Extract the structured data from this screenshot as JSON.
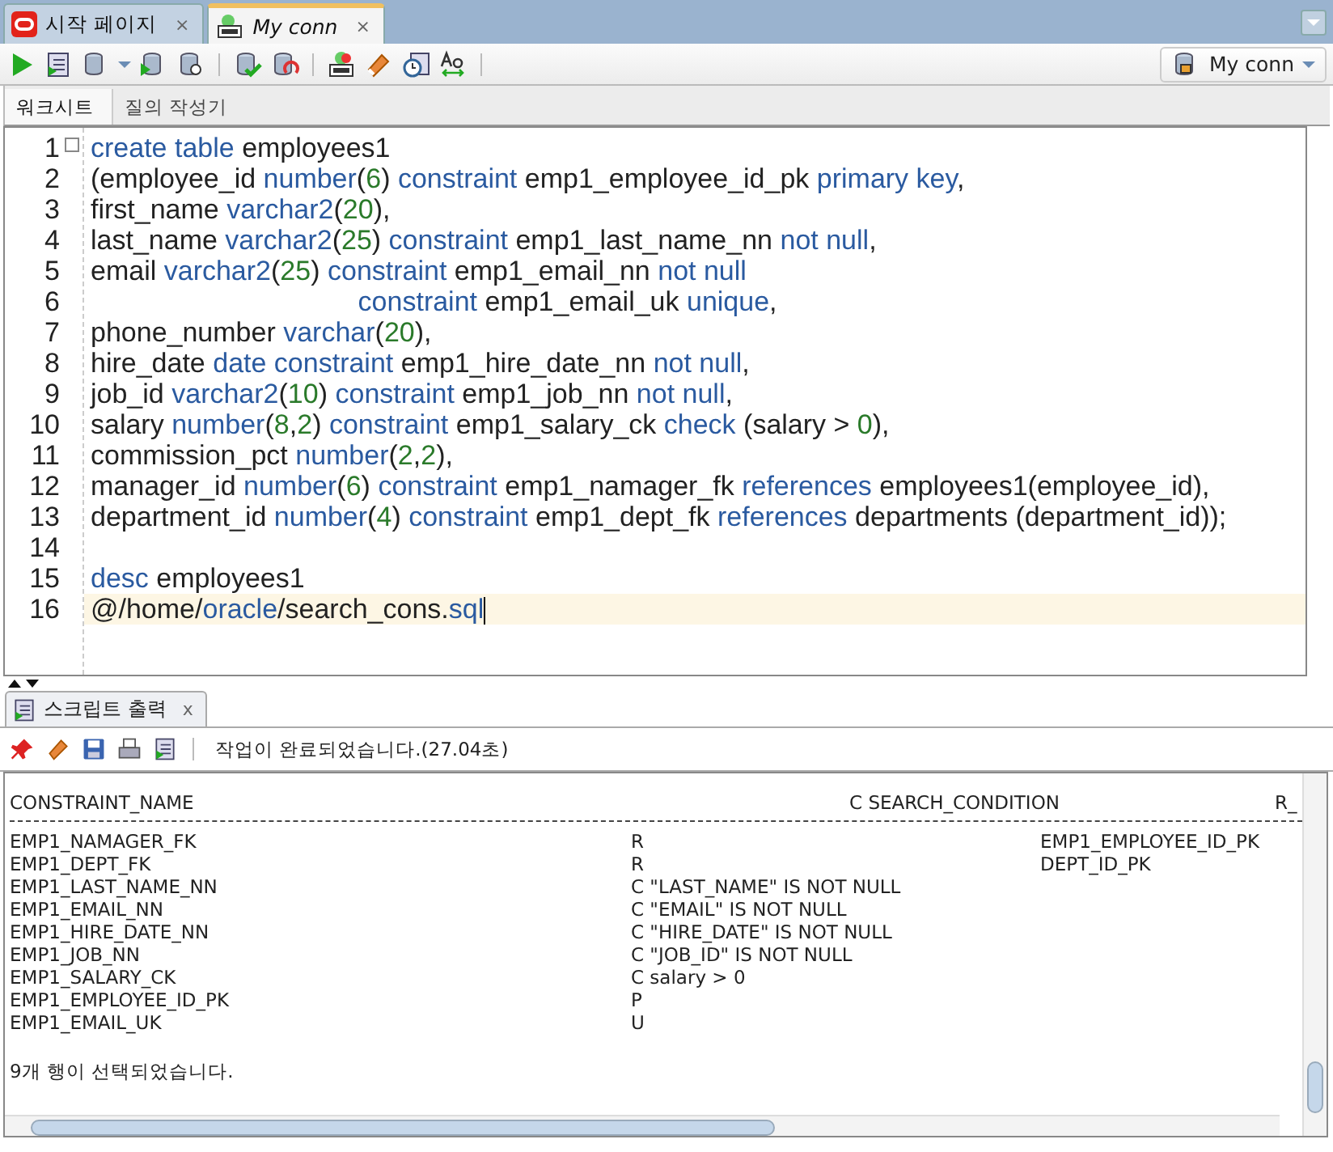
{
  "doc_tabs": [
    {
      "label": "시작 페이지",
      "kind": "start",
      "close": "×",
      "selected": false
    },
    {
      "label": "My conn",
      "kind": "sql",
      "close": "×",
      "selected": true
    }
  ],
  "connection": {
    "label": "My conn"
  },
  "sub_tabs": [
    {
      "label": "워크시트",
      "selected": true
    },
    {
      "label": "질의 작성기",
      "selected": false
    }
  ],
  "editor": {
    "lines": [
      {
        "number": "1",
        "current": false,
        "tokens": [
          {
            "text": "create table",
            "kind": "kw"
          },
          {
            "text": " employees1",
            "kind": "id"
          }
        ]
      },
      {
        "number": "2",
        "current": false,
        "tokens": [
          {
            "text": "(employee_id ",
            "kind": "id"
          },
          {
            "text": "number",
            "kind": "kw"
          },
          {
            "text": "(",
            "kind": "id"
          },
          {
            "text": "6",
            "kind": "num"
          },
          {
            "text": ") ",
            "kind": "id"
          },
          {
            "text": "constraint",
            "kind": "kw"
          },
          {
            "text": " emp1_employee_id_pk ",
            "kind": "id"
          },
          {
            "text": "primary key",
            "kind": "kw"
          },
          {
            "text": ",",
            "kind": "id"
          }
        ]
      },
      {
        "number": "3",
        "current": false,
        "tokens": [
          {
            "text": "first_name ",
            "kind": "id"
          },
          {
            "text": "varchar2",
            "kind": "kw"
          },
          {
            "text": "(",
            "kind": "id"
          },
          {
            "text": "20",
            "kind": "num"
          },
          {
            "text": "),",
            "kind": "id"
          }
        ]
      },
      {
        "number": "4",
        "current": false,
        "tokens": [
          {
            "text": "last_name ",
            "kind": "id"
          },
          {
            "text": "varchar2",
            "kind": "kw"
          },
          {
            "text": "(",
            "kind": "id"
          },
          {
            "text": "25",
            "kind": "num"
          },
          {
            "text": ") ",
            "kind": "id"
          },
          {
            "text": "constraint",
            "kind": "kw"
          },
          {
            "text": " emp1_last_name_nn ",
            "kind": "id"
          },
          {
            "text": "not null",
            "kind": "kw"
          },
          {
            "text": ",",
            "kind": "id"
          }
        ]
      },
      {
        "number": "5",
        "current": false,
        "tokens": [
          {
            "text": "email ",
            "kind": "id"
          },
          {
            "text": "varchar2",
            "kind": "kw"
          },
          {
            "text": "(",
            "kind": "id"
          },
          {
            "text": "25",
            "kind": "num"
          },
          {
            "text": ") ",
            "kind": "id"
          },
          {
            "text": "constraint",
            "kind": "kw"
          },
          {
            "text": " emp1_email_nn ",
            "kind": "id"
          },
          {
            "text": "not null",
            "kind": "kw"
          }
        ]
      },
      {
        "number": "6",
        "current": false,
        "tokens": [
          {
            "text": "                                   constraint",
            "kind": "kw"
          },
          {
            "text": " emp1_email_uk ",
            "kind": "id"
          },
          {
            "text": "unique",
            "kind": "kw"
          },
          {
            "text": ",",
            "kind": "id"
          }
        ]
      },
      {
        "number": "7",
        "current": false,
        "tokens": [
          {
            "text": "phone_number ",
            "kind": "id"
          },
          {
            "text": "varchar",
            "kind": "kw"
          },
          {
            "text": "(",
            "kind": "id"
          },
          {
            "text": "20",
            "kind": "num"
          },
          {
            "text": "),",
            "kind": "id"
          }
        ]
      },
      {
        "number": "8",
        "current": false,
        "tokens": [
          {
            "text": "hire_date ",
            "kind": "id"
          },
          {
            "text": "date constraint",
            "kind": "kw"
          },
          {
            "text": " emp1_hire_date_nn ",
            "kind": "id"
          },
          {
            "text": "not null",
            "kind": "kw"
          },
          {
            "text": ",",
            "kind": "id"
          }
        ]
      },
      {
        "number": "9",
        "current": false,
        "tokens": [
          {
            "text": "job_id ",
            "kind": "id"
          },
          {
            "text": "varchar2",
            "kind": "kw"
          },
          {
            "text": "(",
            "kind": "id"
          },
          {
            "text": "10",
            "kind": "num"
          },
          {
            "text": ") ",
            "kind": "id"
          },
          {
            "text": "constraint",
            "kind": "kw"
          },
          {
            "text": " emp1_job_nn ",
            "kind": "id"
          },
          {
            "text": "not null",
            "kind": "kw"
          },
          {
            "text": ",",
            "kind": "id"
          }
        ]
      },
      {
        "number": "10",
        "current": false,
        "tokens": [
          {
            "text": "salary ",
            "kind": "id"
          },
          {
            "text": "number",
            "kind": "kw"
          },
          {
            "text": "(",
            "kind": "id"
          },
          {
            "text": "8",
            "kind": "num"
          },
          {
            "text": ",",
            "kind": "id"
          },
          {
            "text": "2",
            "kind": "num"
          },
          {
            "text": ") ",
            "kind": "id"
          },
          {
            "text": "constraint",
            "kind": "kw"
          },
          {
            "text": " emp1_salary_ck ",
            "kind": "id"
          },
          {
            "text": "check",
            "kind": "kw"
          },
          {
            "text": " (salary > ",
            "kind": "id"
          },
          {
            "text": "0",
            "kind": "num"
          },
          {
            "text": "),",
            "kind": "id"
          }
        ]
      },
      {
        "number": "11",
        "current": false,
        "tokens": [
          {
            "text": "commission_pct ",
            "kind": "id"
          },
          {
            "text": "number",
            "kind": "kw"
          },
          {
            "text": "(",
            "kind": "id"
          },
          {
            "text": "2",
            "kind": "num"
          },
          {
            "text": ",",
            "kind": "id"
          },
          {
            "text": "2",
            "kind": "num"
          },
          {
            "text": "),",
            "kind": "id"
          }
        ]
      },
      {
        "number": "12",
        "current": false,
        "tokens": [
          {
            "text": "manager_id ",
            "kind": "id"
          },
          {
            "text": "number",
            "kind": "kw"
          },
          {
            "text": "(",
            "kind": "id"
          },
          {
            "text": "6",
            "kind": "num"
          },
          {
            "text": ") ",
            "kind": "id"
          },
          {
            "text": "constraint",
            "kind": "kw"
          },
          {
            "text": " emp1_namager_fk ",
            "kind": "id"
          },
          {
            "text": "references",
            "kind": "kw"
          },
          {
            "text": " employees1(employee_id),",
            "kind": "id"
          }
        ]
      },
      {
        "number": "13",
        "current": false,
        "tokens": [
          {
            "text": "department_id ",
            "kind": "id"
          },
          {
            "text": "number",
            "kind": "kw"
          },
          {
            "text": "(",
            "kind": "id"
          },
          {
            "text": "4",
            "kind": "num"
          },
          {
            "text": ") ",
            "kind": "id"
          },
          {
            "text": "constraint",
            "kind": "kw"
          },
          {
            "text": " emp1_dept_fk ",
            "kind": "id"
          },
          {
            "text": "references",
            "kind": "kw"
          },
          {
            "text": " departments (department_id));",
            "kind": "id"
          }
        ]
      },
      {
        "number": "14",
        "current": false
      },
      {
        "number": "15",
        "current": false,
        "tokens": [
          {
            "text": "desc",
            "kind": "kw"
          },
          {
            "text": " employees1",
            "kind": "id"
          }
        ]
      },
      {
        "number": "16",
        "current": true,
        "tokens": [
          {
            "text": "@/home/",
            "kind": "id"
          },
          {
            "text": "oracle",
            "kind": "kw"
          },
          {
            "text": "/search_cons.",
            "kind": "id"
          },
          {
            "text": "sql",
            "kind": "kw"
          }
        ]
      }
    ]
  },
  "output_tab": {
    "label": "스크립트 출력",
    "close": "x"
  },
  "output_status": "작업이 완료되었습니다.(27.04초)",
  "output": {
    "headers": [
      "CONSTRAINT_NAME",
      "C SEARCH_CONDITION",
      "R_"
    ],
    "rows": [
      {
        "name": "EMP1_NAMAGER_FK",
        "condition": "R",
        "reference": "EMP1_EMPLOYEE_ID_PK"
      },
      {
        "name": "EMP1_DEPT_FK",
        "condition": "R",
        "reference": "DEPT_ID_PK"
      },
      {
        "name": "EMP1_LAST_NAME_NN",
        "condition": "C \"LAST_NAME\" IS NOT NULL"
      },
      {
        "name": "EMP1_EMAIL_NN",
        "condition": "C \"EMAIL\" IS NOT NULL"
      },
      {
        "name": "EMP1_HIRE_DATE_NN",
        "condition": "C \"HIRE_DATE\" IS NOT NULL"
      },
      {
        "name": "EMP1_JOB_NN",
        "condition": "C \"JOB_ID\" IS NOT NULL"
      },
      {
        "name": "EMP1_SALARY_CK",
        "condition": "C salary > 0"
      },
      {
        "name": "EMP1_EMPLOYEE_ID_PK",
        "condition": "P"
      },
      {
        "name": "EMP1_EMAIL_UK",
        "condition": "U"
      }
    ],
    "footer": "9개 행이 선택되었습니다."
  }
}
